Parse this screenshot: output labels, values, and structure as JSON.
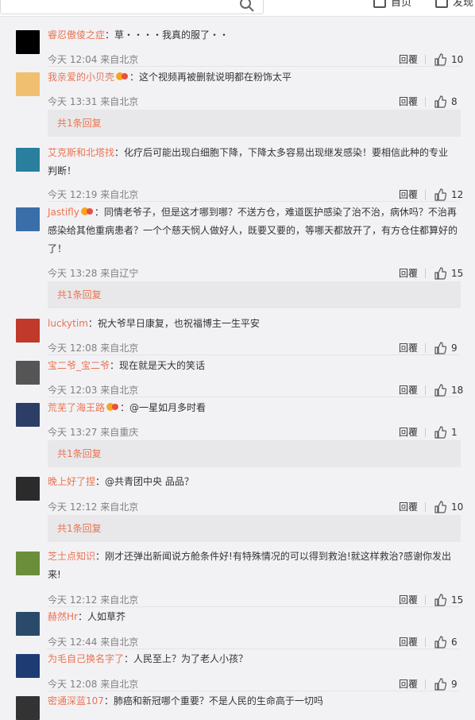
{
  "topbar": {
    "search_placeholder": "",
    "nav_home": "首页",
    "nav_discover": "发现"
  },
  "labels": {
    "reply": "回覆",
    "replies_more": "共1条回复"
  },
  "colors": {
    "username": "#eb7350",
    "meta": "#808080",
    "background": "#f2f2f5"
  },
  "comments": [
    {
      "user": "睿忍傲倰之症",
      "text": "：草・・・・我真的服了・・",
      "time": "今天 12:04 来自北京",
      "likes": "10",
      "badge": false,
      "avatar_color": "#000000"
    },
    {
      "user": "我亲爱的小贝壳",
      "text": "：这个视频再被删就说明都在粉饰太平",
      "time": "今天 13:31 来自北京",
      "likes": "8",
      "badge": true,
      "avatar_color": "#f0c070",
      "reply_bar": "共1条回复"
    },
    {
      "user": "艾克斯和北塔找",
      "text": "：化疗后可能出现白细胞下降，下降太多容易出现继发感染！要相信此种的专业判断！",
      "time": "今天 12:19 来自北京",
      "likes": "12",
      "badge": false,
      "avatar_color": "#2a7f9e"
    },
    {
      "user": "Jastifly",
      "text": "：同情老爷子，但是这才哪到哪？不送方仓，难道医护感染了治不治，病休吗？不治再感染给其他重病患者？一个个慈天悯人做好人，既要又要的，等哪天都放开了，有方仓住都算好的了！",
      "time": "今天 13:28 来自辽宁",
      "likes": "15",
      "badge": true,
      "avatar_color": "#3a6ea8",
      "reply_bar": "共1条回复"
    },
    {
      "user": "luckytim",
      "text": "：祝大爷早日康复，也祝福博主一生平安",
      "time": "今天 12:08 来自北京",
      "likes": "9",
      "badge": false,
      "avatar_color": "#c0392b"
    },
    {
      "user": "宝二爷_宝二爷",
      "text": "：现在就是天大的笑话",
      "time": "今天 12:03 来自北京",
      "likes": "18",
      "badge": false,
      "avatar_color": "#555555"
    },
    {
      "user": "荒芜了海王路",
      "text": "：@一星如月多时看",
      "time": "今天 13:27 来自重庆",
      "likes": "1",
      "badge": true,
      "avatar_color": "#2c3e66",
      "reply_bar": "共1条回复"
    },
    {
      "user": "晚上好了捏",
      "text": "：@共青团中央 品品？",
      "time": "今天 12:12 来自北京",
      "likes": "10",
      "badge": false,
      "avatar_color": "#2b2b2b",
      "reply_bar": "共1条回复"
    },
    {
      "user": "芝士点知识",
      "text": "：刚才还弹出新闻说方舱条件好!有特殊情况的可以得到救治!就这样救治?感谢你发出来!",
      "time": "今天 12:12 来自北京",
      "likes": "15",
      "badge": false,
      "avatar_color": "#6b8e3a"
    },
    {
      "user": "赫然Hr",
      "text": "：人如草芥",
      "time": "今天 12:44 来自北京",
      "likes": "6",
      "badge": false,
      "avatar_color": "#2a4a6a"
    },
    {
      "user": "为毛自己换名字了",
      "text": "：人民至上？为了老人小孩？",
      "time": "今天 12:08 来自北京",
      "likes": "9",
      "badge": false,
      "avatar_color": "#1f3b73"
    },
    {
      "user": "密通深蓝107",
      "text": "：肺癌和新冠哪个重要？不是人民的生命高于一切吗",
      "time": "",
      "likes": "",
      "badge": false,
      "avatar_color": "#333333"
    }
  ]
}
